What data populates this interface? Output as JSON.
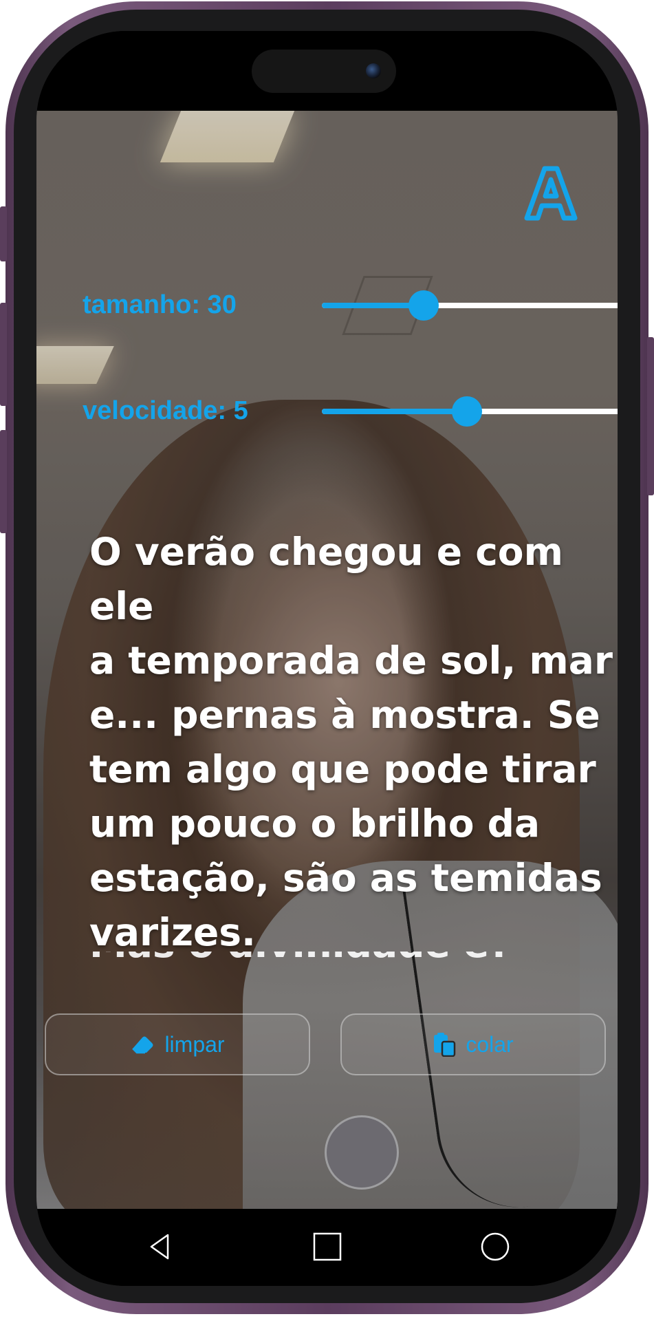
{
  "controls": {
    "size": {
      "label": "tamanho: 30",
      "value": 30,
      "fraction": 0.315
    },
    "speed": {
      "label": "velocidade: 5",
      "value": 5,
      "fraction": 0.45
    }
  },
  "script": {
    "current_lines": [
      "O verão chegou e com ele",
      "a temporada de sol, mar",
      "e... pernas à mostra. Se",
      "tem algo que pode tirar",
      "um pouco o brilho da",
      "estação, são as temidas",
      "varizes."
    ],
    "next_line_partial": "Mas o divinidade é? Não"
  },
  "actions": {
    "clear_label": "limpar",
    "paste_label": "colar"
  },
  "icons": {
    "logo": "letter-a-logo-icon",
    "clear": "eraser-icon",
    "paste": "clipboard-icon",
    "nav_back": "triangle-back-icon",
    "nav_home": "square-home-icon",
    "nav_recents": "circle-recents-icon"
  },
  "colors": {
    "accent": "#14a4ea",
    "frame": "#5b3d5e",
    "text": "#ffffff"
  }
}
